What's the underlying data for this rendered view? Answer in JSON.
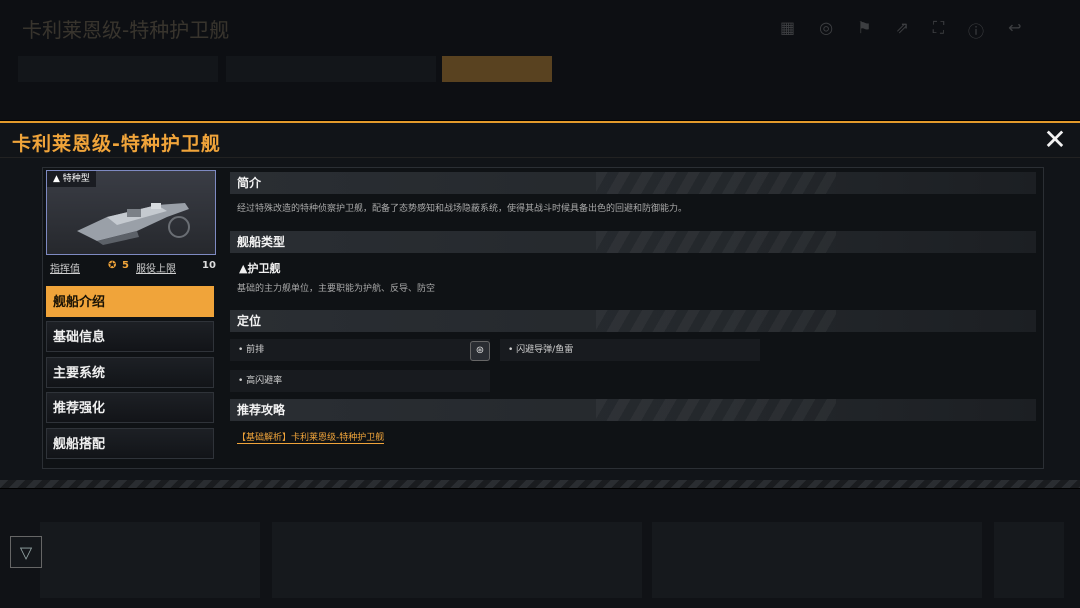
{
  "modal": {
    "title": "卡利莱恩级-特种护卫舰",
    "close_label": "✕"
  },
  "ship_card": {
    "tag": "▲ 特种型",
    "command_label": "指挥值",
    "command_value": "5",
    "service_label": "服役上限",
    "service_value": "10"
  },
  "nav": {
    "items": [
      {
        "label": "舰船介绍",
        "active": true
      },
      {
        "label": "基础信息",
        "active": false
      },
      {
        "label": "主要系统",
        "active": false
      },
      {
        "label": "推荐强化",
        "active": false
      },
      {
        "label": "舰船搭配",
        "active": false
      }
    ]
  },
  "sections": {
    "intro": {
      "heading": "简介",
      "text": "经过特殊改造的特种侦察护卫舰，配备了态势感知和战场隐蔽系统，使得其战斗时候具备出色的回避和防御能力。"
    },
    "type": {
      "heading": "舰船类型",
      "title": "▲护卫舰",
      "text": "基础的主力舰单位，主要职能为护航、反导、防空"
    },
    "position": {
      "heading": "定位",
      "cells": [
        "• 前排",
        "• 闪避导弹/鱼雷",
        "• 高闪避率"
      ]
    },
    "guide": {
      "heading": "推荐攻略",
      "link": "【基础解析】卡利莱恩级-特种护卫舰"
    }
  },
  "background": {
    "title": "卡利莱恩级-特种护卫舰"
  },
  "colors": {
    "accent": "#f0a43a",
    "panel": "#111418"
  }
}
